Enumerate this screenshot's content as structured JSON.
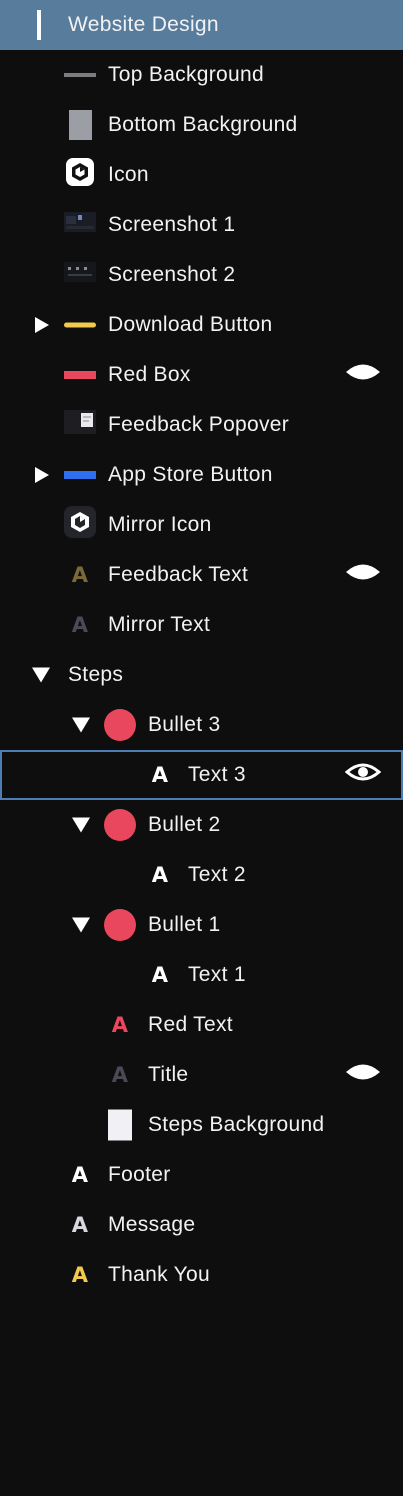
{
  "colors": {
    "header_bg": "#587c9c",
    "panel_bg": "#0e0e0f",
    "selection_border": "#4e7db6",
    "red": "#e8475e",
    "yellow": "#f2c94c",
    "blue": "#2f6fed"
  },
  "header": {
    "label": "Website Design"
  },
  "layers": [
    {
      "label": "Top Background",
      "icon": "gray-bar-icon"
    },
    {
      "label": "Bottom Background",
      "icon": "gray-rect-icon"
    },
    {
      "label": "Icon",
      "icon": "mirror-logo-icon"
    },
    {
      "label": "Screenshot 1",
      "icon": "screenshot-thumbnail-icon"
    },
    {
      "label": "Screenshot 2",
      "icon": "screenshot-thumbnail-icon"
    },
    {
      "label": "Download Button",
      "icon": "yellow-bar-icon",
      "collapsed": true
    },
    {
      "label": "Red Box",
      "icon": "red-bar-icon",
      "hidden": true
    },
    {
      "label": "Feedback Popover",
      "icon": "popover-thumbnail-icon"
    },
    {
      "label": "App Store Button",
      "icon": "blue-bar-icon",
      "collapsed": true
    },
    {
      "label": "Mirror Icon",
      "icon": "mirror-logo-icon"
    },
    {
      "label": "Feedback Text",
      "icon": "text-icon",
      "hidden": true
    },
    {
      "label": "Mirror Text",
      "icon": "text-icon"
    }
  ],
  "steps": {
    "label": "Steps",
    "children": [
      {
        "label": "Bullet 3",
        "text": "Text 3",
        "text_selected": true,
        "text_visible_eye": true
      },
      {
        "label": "Bullet 2",
        "text": "Text 2"
      },
      {
        "label": "Bullet 1",
        "text": "Text 1"
      },
      {
        "label": "Red Text",
        "icon": "text-icon"
      },
      {
        "label": "Title",
        "icon": "text-icon",
        "hidden": true
      },
      {
        "label": "Steps Background",
        "icon": "white-rect-icon"
      }
    ]
  },
  "bottom": [
    {
      "label": "Footer",
      "icon": "text-icon"
    },
    {
      "label": "Message",
      "icon": "text-icon"
    },
    {
      "label": "Thank You",
      "icon": "text-icon"
    }
  ]
}
